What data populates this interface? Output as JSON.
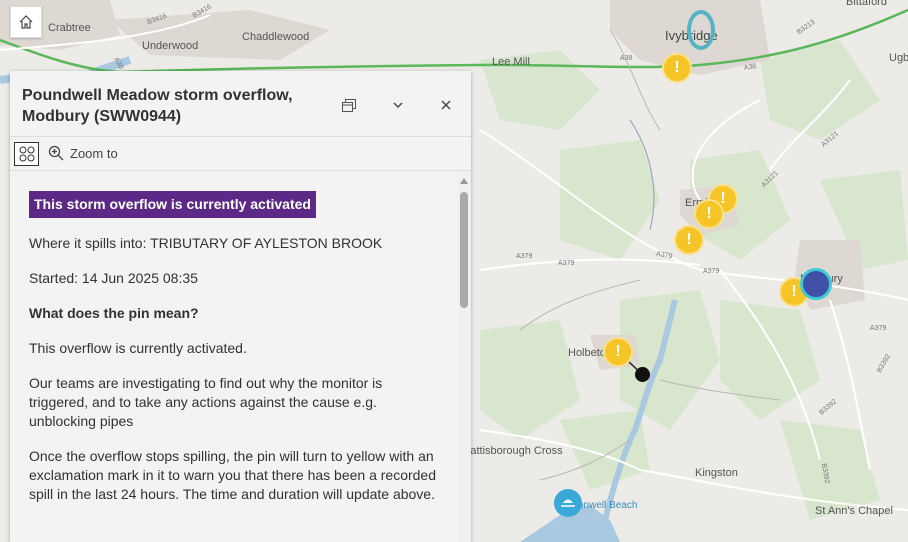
{
  "map": {
    "places": {
      "crabtree": "Crabtree",
      "underwood": "Underwood",
      "chaddlewood": "Chaddlewood",
      "lee_mill": "Lee Mill",
      "ivybridge": "Ivybridge",
      "bittaford": "Bittaford",
      "ugb": "Ugb",
      "ermington": "Ermi",
      "modbury": "Modbury",
      "holbeton": "Holbeto",
      "battisborough_cross": "Battisborough Cross",
      "kingston": "Kingston",
      "wonwell_beach": "onwell Beach",
      "st_anns_chapel": "St Ann's Chapel"
    },
    "roads": {
      "b3416": "B3416",
      "b3416b": "B3416",
      "a38a": "A38",
      "a38b": "A38",
      "a38c": "A38",
      "b3213": "B3213",
      "a3121": "A3121",
      "a3121b": "A3121",
      "a379a": "A379",
      "a379b": "A379",
      "a379c": "A379",
      "a379d": "A379",
      "a379e": "A379",
      "b3392a": "B3392",
      "b3392b": "B3392",
      "b3392c": "B3392"
    }
  },
  "home_icon": "home-icon",
  "popup": {
    "title": "Poundwell Meadow storm overflow, Modbury (SWW0944)",
    "dock_icon": "dock-icon",
    "collapse_icon": "chevron-down-icon",
    "close_icon": "close-icon",
    "features_icon": "features-grid-icon",
    "zoom_label": "Zoom to",
    "status_badge": "This storm overflow is currently activated",
    "spills_into": "Where it spills into: TRIBUTARY OF AYLESTON BROOK",
    "started": "Started: 14 Jun 2025 08:35",
    "pin_heading": "What does the pin mean?",
    "pin_meaning": "This overflow is currently activated.",
    "investigating": "Our teams are investigating to find out why the monitor is triggered, and to take any actions against the cause e.g. unblocking pipes",
    "once_stops": "Once the overflow stops spilling, the pin will turn to yellow with an exclamation mark in it to warn you that there has been a recorded spill in the last 24 hours. The time and duration will update above."
  },
  "colors": {
    "badge": "#5c2a86",
    "warning_pin": "#f5c427",
    "active_pin": "#3f51a5",
    "road_green": "#5ab85a",
    "water": "#a9c9e0",
    "beach_pin": "#3aa8d8"
  }
}
